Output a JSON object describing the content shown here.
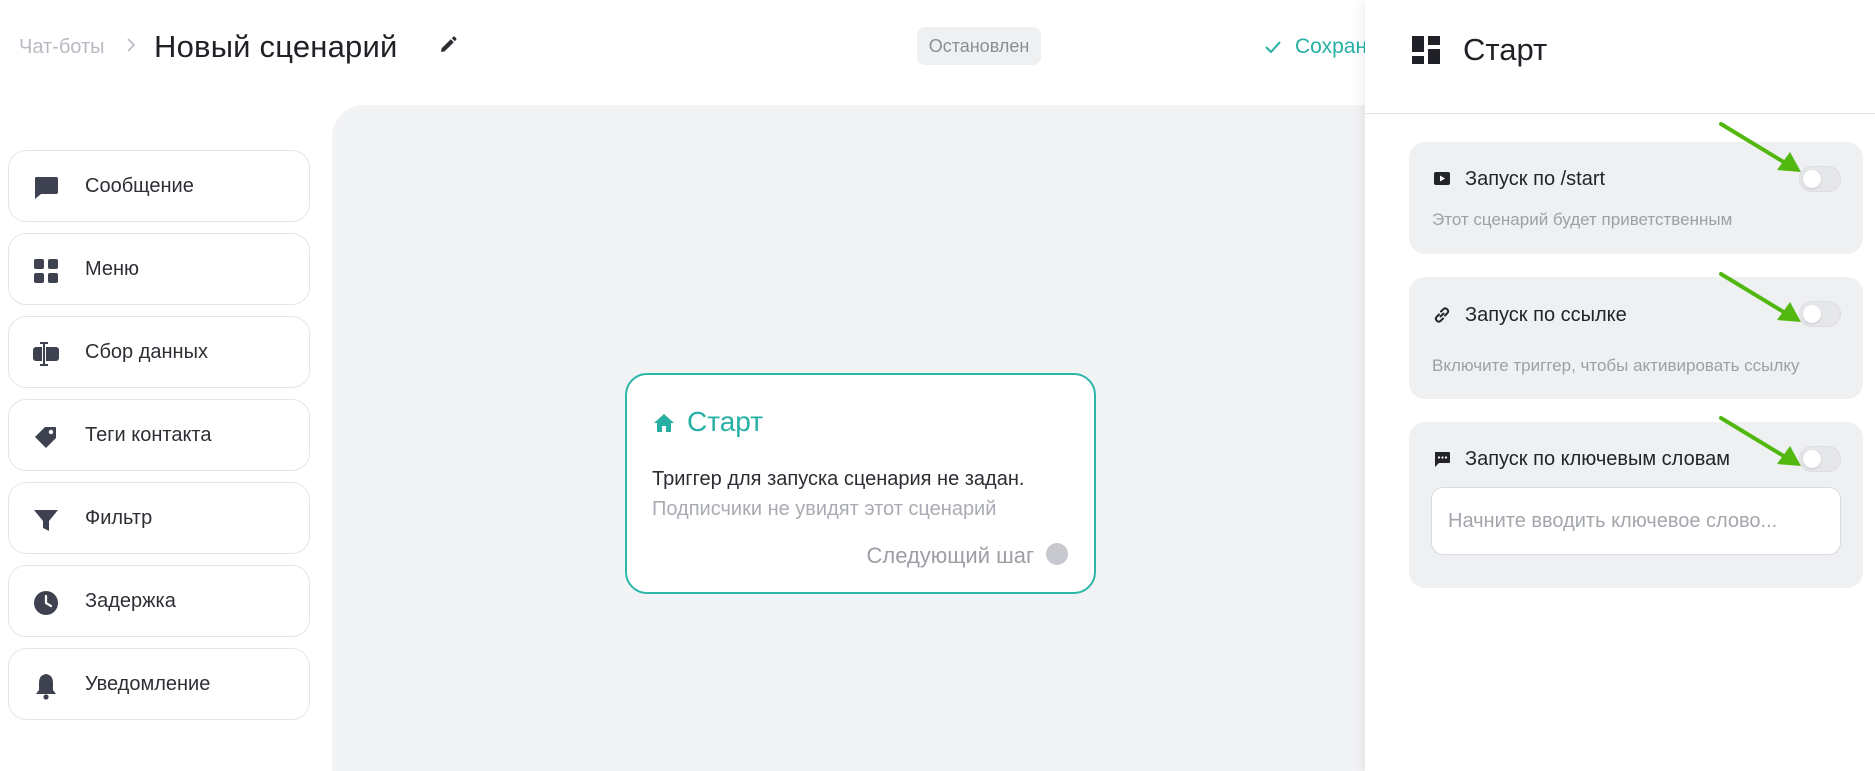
{
  "header": {
    "breadcrumb_root": "Чат-боты",
    "title": "Новый сценарий",
    "status": "Остановлен",
    "save_label": "Сохран"
  },
  "palette": {
    "items": [
      {
        "label": "Сообщение",
        "icon": "message-icon"
      },
      {
        "label": "Меню",
        "icon": "menu-grid-icon"
      },
      {
        "label": "Сбор данных",
        "icon": "data-collection-icon"
      },
      {
        "label": "Теги контакта",
        "icon": "tag-icon"
      },
      {
        "label": "Фильтр",
        "icon": "filter-icon"
      },
      {
        "label": "Задержка",
        "icon": "clock-icon"
      },
      {
        "label": "Уведомление",
        "icon": "bell-icon"
      }
    ]
  },
  "start_node": {
    "title": "Старт",
    "line1": "Триггер для запуска сценария не задан.",
    "line2": "Подписчики не увидят этот сценарий",
    "next_step": "Следующий шаг"
  },
  "panel": {
    "title": "Старт",
    "triggers": [
      {
        "title": "Запуск по /start",
        "description": "Этот сценарий будет приветственным",
        "enabled": false
      },
      {
        "title": "Запуск по ссылке",
        "description": "Включите триггер, чтобы активировать ссылку",
        "enabled": false
      },
      {
        "title": "Запуск по ключевым словам",
        "placeholder": "Начните вводить ключевое слово...",
        "value": "",
        "enabled": false
      }
    ]
  },
  "colors": {
    "accent": "#26b0a4",
    "canvas_bg": "#f2f3f5",
    "card_bg": "#eef0f2",
    "annotation_arrow": "#52b80f"
  }
}
